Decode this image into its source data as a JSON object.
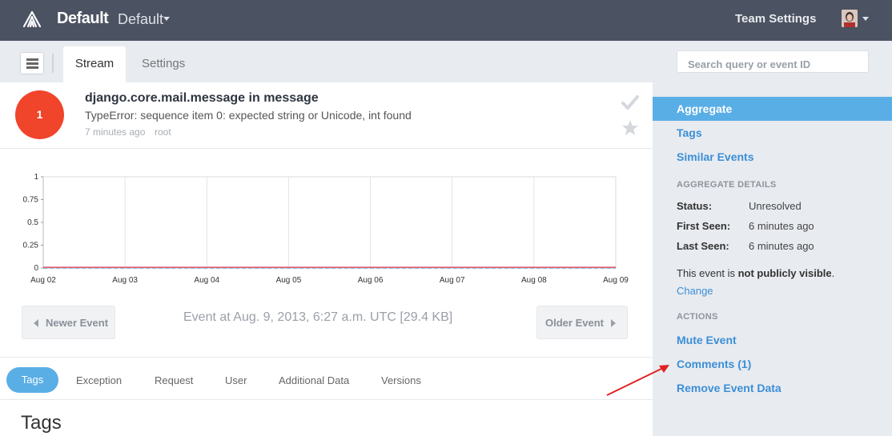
{
  "header": {
    "brand": "Default",
    "project": "Default",
    "team_settings": "Team Settings"
  },
  "subnav": {
    "tabs": [
      {
        "label": "Stream",
        "active": true
      },
      {
        "label": "Settings",
        "active": false
      }
    ],
    "search_placeholder": "Search query or event ID"
  },
  "event": {
    "count": "1",
    "title": "django.core.mail.message in message",
    "message": "TypeError: sequence item 0: expected string or Unicode, int found",
    "time_ago": "7 minutes ago",
    "user": "root"
  },
  "chart_data": {
    "type": "line",
    "x": [
      "Aug 02",
      "Aug 03",
      "Aug 04",
      "Aug 05",
      "Aug 06",
      "Aug 07",
      "Aug 08",
      "Aug 09"
    ],
    "series": [
      {
        "values": [
          0,
          0,
          0,
          0,
          0,
          0,
          0,
          0
        ],
        "color": "#5aaee6"
      },
      {
        "values": [
          0,
          0,
          0,
          0,
          0,
          0,
          0,
          0
        ],
        "color": "#e05c6a"
      }
    ],
    "yticks": [
      "0",
      "0.25",
      "0.5",
      "0.75",
      "1"
    ],
    "ylim": [
      0,
      1
    ],
    "grid": true,
    "title": "",
    "xlabel": "",
    "ylabel": ""
  },
  "pager": {
    "newer": "Newer Event",
    "older": "Older Event",
    "event_at": "Event at Aug. 9, 2013, 6:27 a.m. UTC [29.4 KB]"
  },
  "detail_tabs": [
    "Tags",
    "Exception",
    "Request",
    "User",
    "Additional Data",
    "Versions"
  ],
  "section_title": "Tags",
  "sidebar": {
    "nav": [
      "Aggregate",
      "Tags",
      "Similar Events"
    ],
    "details_heading": "AGGREGATE DETAILS",
    "status_label": "Status:",
    "status_value": "Unresolved",
    "first_seen_label": "First Seen:",
    "first_seen_value": "6 minutes ago",
    "last_seen_label": "Last Seen:",
    "last_seen_value": "6 minutes ago",
    "visibility_prefix": "This event is ",
    "visibility_strong": "not publicly visible",
    "visibility_suffix": ".",
    "change": "Change",
    "actions_heading": "ACTIONS",
    "actions": [
      "Mute Event",
      "Comments (1)",
      "Remove Event Data"
    ]
  },
  "colors": {
    "accent": "#5aaee6",
    "badge": "#f0452b",
    "link": "#3b8fd6",
    "header_bg": "#4b5261",
    "annotation_arrow": "#e02020"
  }
}
